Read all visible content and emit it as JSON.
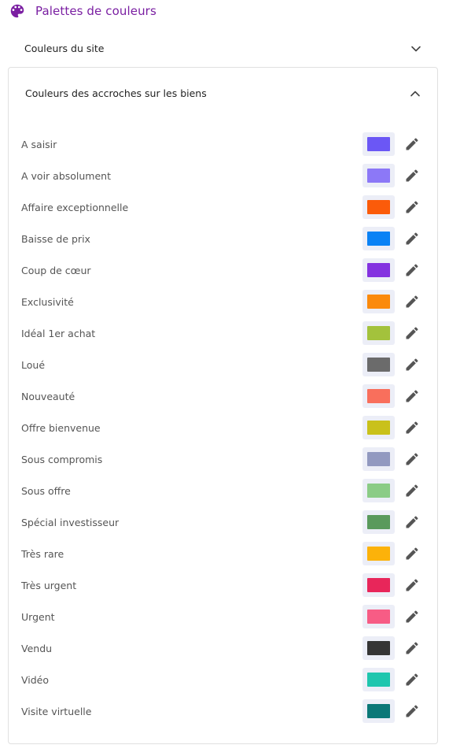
{
  "header": {
    "title": "Palettes de couleurs",
    "icon": "palette-icon",
    "accent_color": "#7b1fa2"
  },
  "sections": {
    "site": {
      "label": "Couleurs du site",
      "expanded": false
    },
    "tags": {
      "label": "Couleurs des accroches sur les biens",
      "expanded": true
    }
  },
  "tags": [
    {
      "label": "A saisir",
      "color": "#6b57f5"
    },
    {
      "label": "A voir absolument",
      "color": "#8c78f7"
    },
    {
      "label": "Affaire exceptionnelle",
      "color": "#fb5b0a"
    },
    {
      "label": "Baisse de prix",
      "color": "#0a82f5"
    },
    {
      "label": "Coup de cœur",
      "color": "#8432e0"
    },
    {
      "label": "Exclusivité",
      "color": "#fb8a0c"
    },
    {
      "label": "Idéal 1er achat",
      "color": "#a3c23c"
    },
    {
      "label": "Loué",
      "color": "#6b6b6b"
    },
    {
      "label": "Nouveauté",
      "color": "#f96f5c"
    },
    {
      "label": "Offre bienvenue",
      "color": "#c9c11b"
    },
    {
      "label": "Sous compromis",
      "color": "#9299c0"
    },
    {
      "label": "Sous offre",
      "color": "#8bcc86"
    },
    {
      "label": "Spécial investisseur",
      "color": "#5a9a5c"
    },
    {
      "label": "Très rare",
      "color": "#fcb20a"
    },
    {
      "label": "Très urgent",
      "color": "#e8265a"
    },
    {
      "label": "Urgent",
      "color": "#f75c85"
    },
    {
      "label": "Vendu",
      "color": "#353535"
    },
    {
      "label": "Vidéo",
      "color": "#1fc6ae"
    },
    {
      "label": "Visite virtuelle",
      "color": "#0b7878"
    }
  ]
}
